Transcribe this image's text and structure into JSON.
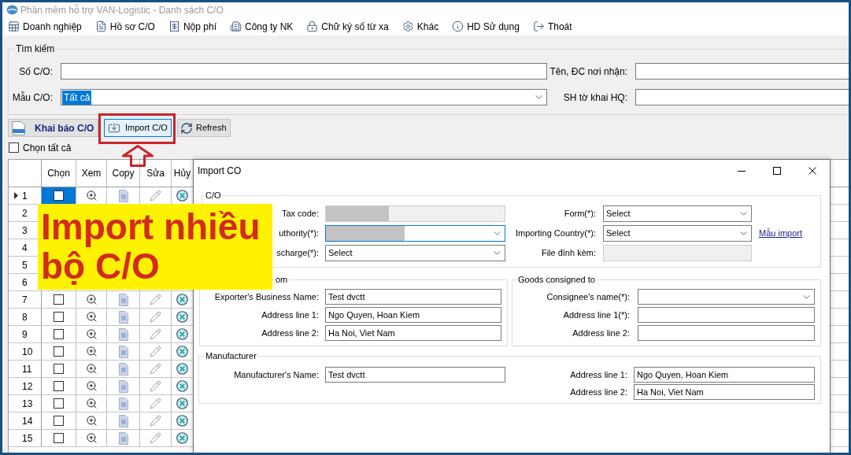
{
  "window": {
    "title": "Phần mềm hỗ trợ VAN-Logistic - Danh sách C/O"
  },
  "menu": [
    "Doanh nghiệp",
    "Hồ sơ C/O",
    "Nộp phí",
    "Công ty NK",
    "Chữ ký số từ xa",
    "Khác",
    "HD Sử dụng",
    "Thoát"
  ],
  "search": {
    "legend": "Tìm kiếm",
    "fields": [
      {
        "label": "Số C/O:",
        "kind": "text"
      },
      {
        "label": "Tên, ĐC nơi nhận:",
        "kind": "text"
      },
      {
        "label": "Mẫu C/O:",
        "kind": "select",
        "value": "Tất cả",
        "text_selected": true
      },
      {
        "label": "SH tờ khai HQ:",
        "kind": "text"
      }
    ]
  },
  "toolbar": [
    {
      "label": "Khai báo C/O",
      "kind": "new",
      "focused": false
    },
    {
      "label": "Import C/O",
      "kind": "import",
      "focused": true
    },
    {
      "label": "Refresh",
      "kind": "refresh",
      "focused": false
    }
  ],
  "select_all": {
    "label": "Chọn tất cả",
    "checked": false
  },
  "grid": {
    "columns": [
      "Chọn",
      "Xem",
      "Copy",
      "Sửa",
      "Hủy"
    ],
    "rows": [
      {
        "number": "1",
        "kind": "full",
        "selected": true,
        "checked": false
      },
      {
        "number": "2",
        "kind": "number_only",
        "selected": false
      },
      {
        "number": "3",
        "kind": "number_only",
        "selected": false
      },
      {
        "number": "4",
        "kind": "number_only",
        "selected": false
      },
      {
        "number": "5",
        "kind": "number_only",
        "selected": false
      },
      {
        "number": "6",
        "kind": "number_only",
        "selected": false
      },
      {
        "number": "7",
        "kind": "full",
        "selected": false,
        "checked": false
      },
      {
        "number": "8",
        "kind": "full",
        "selected": false,
        "checked": false
      },
      {
        "number": "9",
        "kind": "full",
        "selected": false,
        "checked": false
      },
      {
        "number": "10",
        "kind": "full",
        "selected": false,
        "checked": false
      },
      {
        "number": "11",
        "kind": "full",
        "selected": false,
        "checked": false
      },
      {
        "number": "12",
        "kind": "full",
        "selected": false,
        "checked": false
      },
      {
        "number": "13",
        "kind": "full",
        "selected": false,
        "checked": false
      },
      {
        "number": "14",
        "kind": "full",
        "selected": false,
        "checked": false
      },
      {
        "number": "15",
        "kind": "full",
        "selected": false,
        "checked": false
      }
    ]
  },
  "callout": {
    "lines": [
      "Import nhiều",
      "bộ C/O"
    ]
  },
  "dialog": {
    "title": "Import CO",
    "co_group": {
      "legend": "C/O",
      "left": [
        {
          "label": "Tax code:",
          "kind": "redacted_disabled",
          "focused": false
        },
        {
          "label": "uthority(*):",
          "kind": "redacted_select",
          "focused": true
        },
        {
          "label": "scharge(*):",
          "kind": "select",
          "value": "Select",
          "focused": false
        }
      ],
      "right": [
        {
          "label": "Form(*):",
          "kind": "select",
          "value": "Select",
          "focused": false
        },
        {
          "label": "Importing Country(*):",
          "kind": "select",
          "value": "Select",
          "focused": false,
          "link": "Mẫu import"
        },
        {
          "label": "File đính kèm:",
          "kind": "disabled",
          "focused": false
        }
      ]
    },
    "exporter_group": {
      "legend": "om",
      "fields": [
        {
          "label": "Exporter's Business Name:",
          "kind": "text",
          "value": "Test dvctt"
        },
        {
          "label": "Address line 1:",
          "kind": "text",
          "value": "Ngo Quyen, Hoan Kiem"
        },
        {
          "label": "Address line 2:",
          "kind": "text",
          "value": "Ha Noi, Viet Nam"
        }
      ]
    },
    "consignee_group": {
      "legend": "Goods consigned to",
      "fields": [
        {
          "label": "Consignee's name(*):",
          "kind": "select"
        },
        {
          "label": "Address line 1(*):",
          "kind": "text"
        },
        {
          "label": "Address line 2:",
          "kind": "text"
        }
      ]
    },
    "manufacturer_group": {
      "legend": "Manufacturer",
      "left": [
        {
          "label": "Manufacturer's Name:",
          "kind": "text",
          "value": "Test dvctt"
        }
      ],
      "right": [
        {
          "label": "Address line 1:",
          "kind": "text",
          "value": "Ngo Quyen, Hoan Kiem"
        },
        {
          "label": "Address line 2:",
          "kind": "text",
          "value": "Ha Noi, Viet Nam"
        }
      ]
    }
  }
}
